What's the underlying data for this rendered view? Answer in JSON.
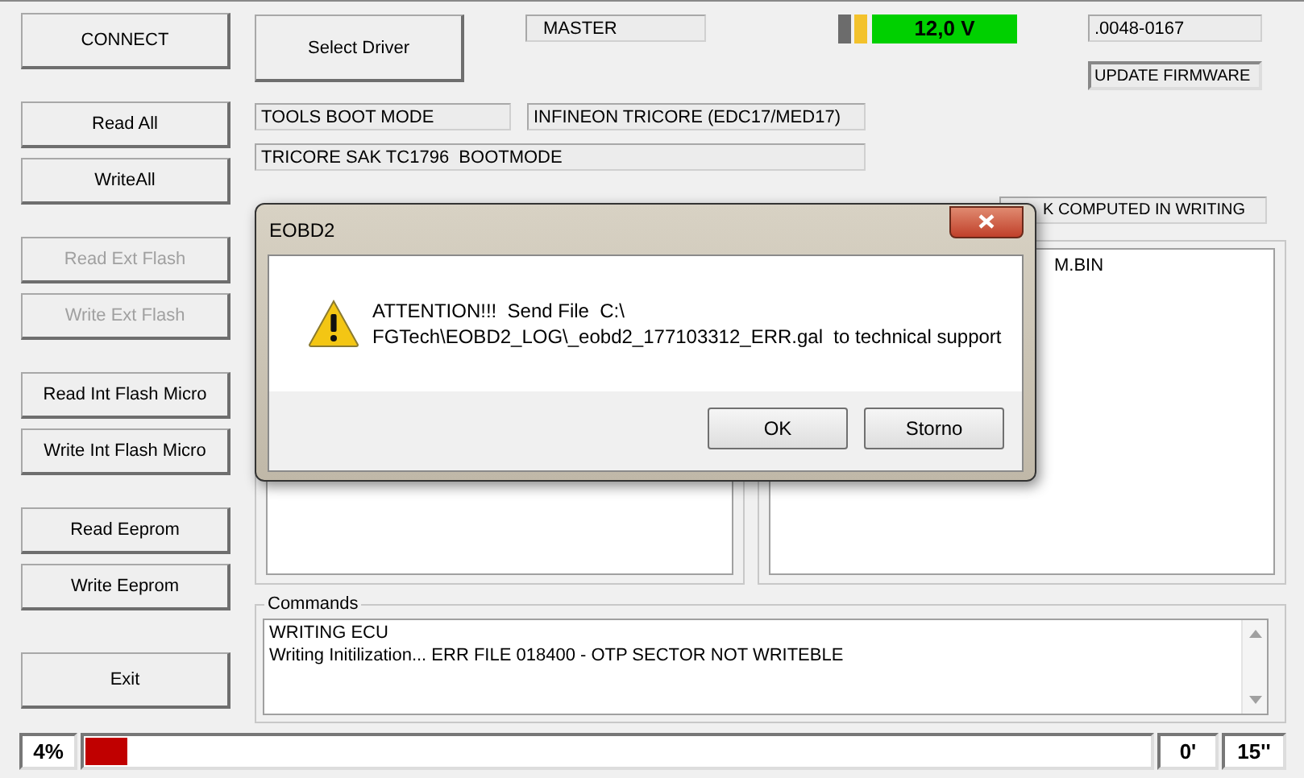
{
  "button_groups": [
    [
      {
        "label": "CONNECT",
        "disabled": false
      }
    ],
    [
      {
        "label": "Read All",
        "disabled": false
      },
      {
        "label": "WriteAll",
        "disabled": false
      }
    ],
    [
      {
        "label": "Read Ext Flash",
        "disabled": true
      },
      {
        "label": "Write Ext Flash",
        "disabled": true
      }
    ],
    [
      {
        "label": "Read Int Flash Micro",
        "disabled": false
      },
      {
        "label": "Write Int Flash Micro",
        "disabled": false
      }
    ],
    [
      {
        "label": "Read Eeprom",
        "disabled": false
      },
      {
        "label": "Write Eeprom",
        "disabled": false
      }
    ],
    [
      {
        "label": "Exit",
        "disabled": false
      }
    ]
  ],
  "driver_button": "Select Driver",
  "mode": "MASTER",
  "voltage": "12,0 V",
  "serial": ".0048-0167",
  "update_button": "UPDATE FIRMWARE",
  "boot_mode": "TOOLS BOOT MODE",
  "ecu_family": "INFINEON TRICORE (EDC17/MED17)",
  "processor": "TRICORE SAK TC1796  BOOTMODE",
  "checksum_status": "K COMPUTED IN WRITING",
  "file_list": [
    "M.BIN"
  ],
  "commands": {
    "title": "Commands",
    "lines": [
      "WRITING ECU",
      "Writing Initilization... ERR FILE 018400 - OTP SECTOR NOT WRITEBLE"
    ]
  },
  "progress": {
    "percent": "4%",
    "level": 0.04,
    "minutes": "0'",
    "seconds": "15''"
  },
  "dialog": {
    "title": "EOBD2",
    "message": [
      "ATTENTION!!!  Send File  C:\\",
      "FGTech\\EOBD2_LOG\\_eobd2_177103312_ERR.gal  to technical support"
    ],
    "buttons": [
      "OK",
      "Storno"
    ]
  }
}
